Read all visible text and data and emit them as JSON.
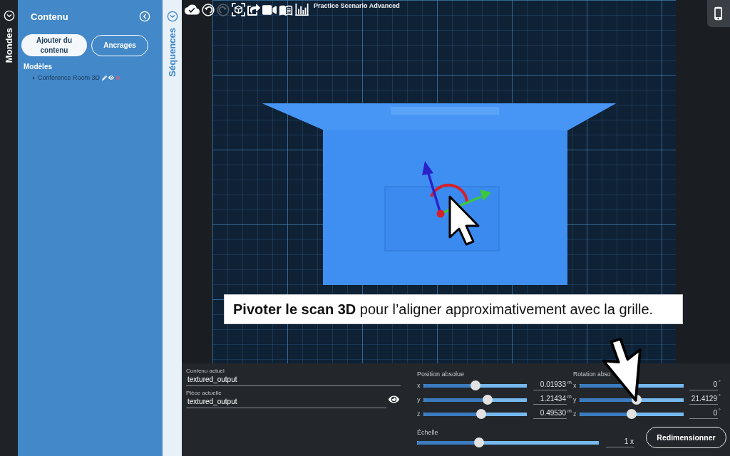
{
  "mondes_rail": {
    "label": "Mondes"
  },
  "content_panel": {
    "title": "Contenu",
    "buttons": [
      {
        "label": "Ajouter du contenu",
        "selected": true
      },
      {
        "label": "Ancrages",
        "selected": false
      }
    ],
    "section_title": "Modèles",
    "models": [
      {
        "name": "Conference Room 3D",
        "expanded": false
      }
    ]
  },
  "sequences_rail": {
    "label": "Séquences"
  },
  "toolbar": {
    "tools": [
      {
        "kind": "cloud",
        "disabled": false
      },
      {
        "kind": "undo",
        "disabled": false
      },
      {
        "kind": "redo",
        "disabled": true
      },
      {
        "kind": "cube",
        "disabled": false
      },
      {
        "kind": "share",
        "disabled": false
      },
      {
        "kind": "video",
        "disabled": false
      },
      {
        "kind": "book",
        "disabled": false
      },
      {
        "kind": "chart",
        "disabled": false
      }
    ],
    "scenario_title": "Practice Scenario Advanced"
  },
  "caption": "**Pivoter le scan 3D** pour l’aligner approximativement avec la grille.",
  "bottom_panel": {
    "fields": [
      {
        "label": "Contenu actuel",
        "value": "textured_output",
        "visibility_toggle": false
      },
      {
        "label": "Pièce actuelle",
        "value": "textured_output",
        "visibility_toggle": true
      }
    ],
    "position": {
      "title": "Position absolue",
      "axes": [
        {
          "axis": "x",
          "level": 0.5,
          "value": "0.01933",
          "unit": "m"
        },
        {
          "axis": "y",
          "level": 0.62,
          "value": "1.21434",
          "unit": "m"
        },
        {
          "axis": "z",
          "level": 0.56,
          "value": "0.49530",
          "unit": "m"
        }
      ]
    },
    "rotation": {
      "title": "Rotation abso",
      "axes": [
        {
          "axis": "x",
          "level": 0.5,
          "value": "0",
          "unit": "°"
        },
        {
          "axis": "y",
          "level": 0.55,
          "value": "21.4129",
          "unit": "°"
        },
        {
          "axis": "z",
          "level": 0.5,
          "value": "0",
          "unit": "°"
        }
      ]
    },
    "scale": {
      "label": "Échelle",
      "level": 0.34,
      "value": "1 x"
    },
    "resize_button": {
      "label": "Redimensionner"
    }
  }
}
